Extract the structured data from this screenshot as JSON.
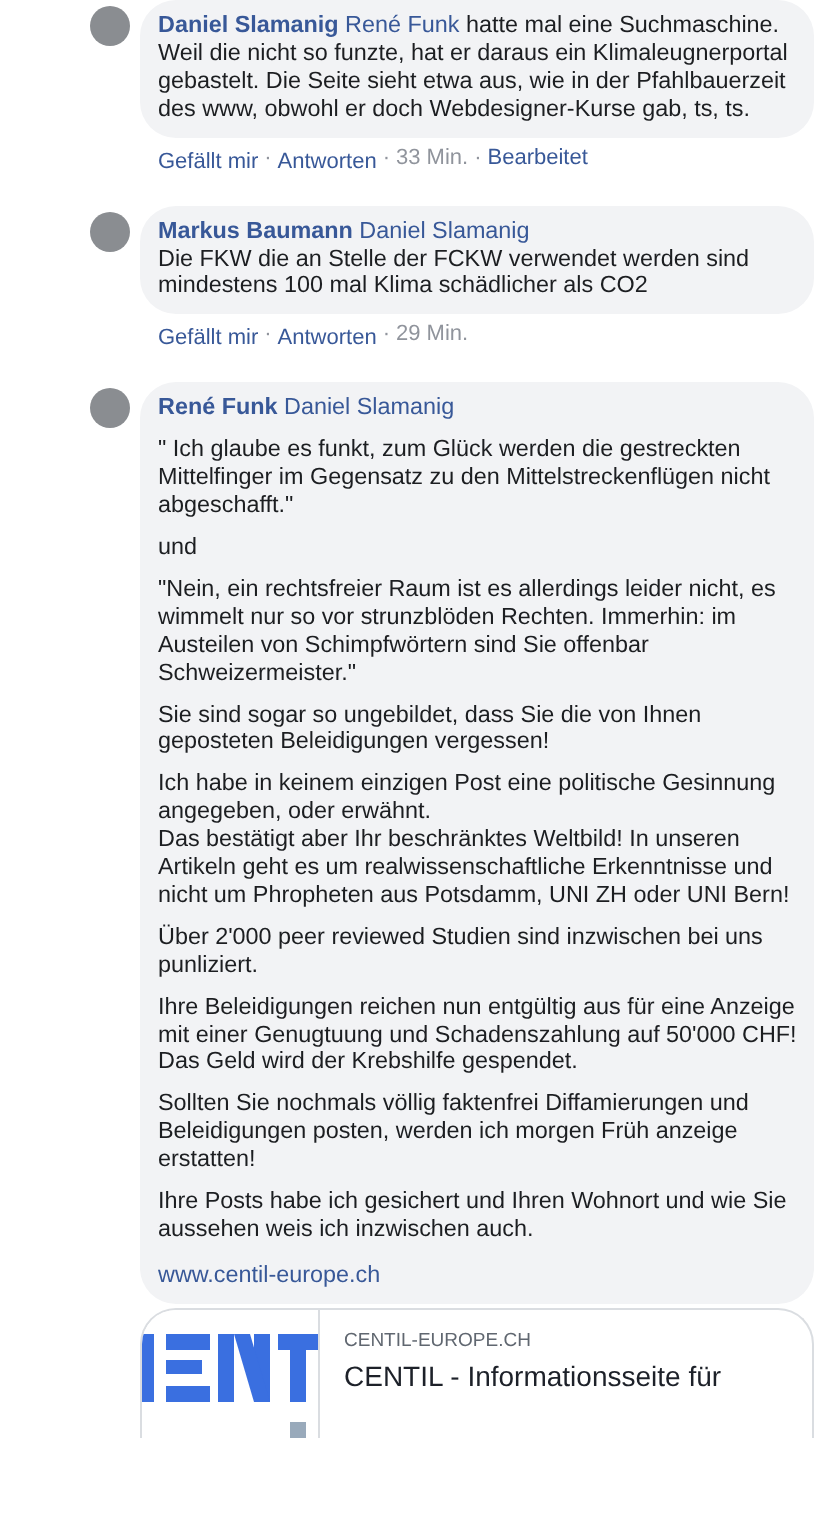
{
  "separator": "·",
  "comments": [
    {
      "author": "Daniel Slamanig",
      "mention": "René Funk",
      "kind": "inline",
      "paragraphs": [
        "hatte mal eine Suchmaschine. Weil die nicht so funzte, hat er daraus ein Klimaleugnerportal gebastelt. Die Seite sieht etwa aus, wie in der Pfahlbauerzeit des www, obwohl er doch Webdesigner-Kurse gab, ts, ts."
      ],
      "meta": [
        {
          "label": "Gefällt mir",
          "kind": "link"
        },
        {
          "label": "Antworten",
          "kind": "link"
        },
        {
          "label": "33 Min.",
          "kind": "time"
        },
        {
          "label": "Bearbeitet",
          "kind": "note"
        }
      ]
    },
    {
      "author": "Markus Baumann",
      "mention": "Daniel Slamanig",
      "kind": "stacked",
      "paragraphs": [
        "Die FKW die an Stelle der FCKW verwendet werden sind mindestens 100 mal Klima schädlicher als CO2"
      ],
      "meta": [
        {
          "label": "Gefällt mir",
          "kind": "link"
        },
        {
          "label": "Antworten",
          "kind": "link"
        },
        {
          "label": "29 Min.",
          "kind": "time"
        }
      ]
    },
    {
      "author": "René Funk",
      "mention": "Daniel Slamanig",
      "kind": "block",
      "paragraphs": [
        "\" Ich glaube es funkt, zum Glück werden die gestreckten Mittelfinger im Gegensatz zu den Mittelstreckenflügen nicht abgeschafft.\"",
        "und",
        "\"Nein, ein rechtsfreier Raum ist es allerdings leider nicht, es wimmelt nur so vor strunzblöden Rechten. Immerhin: im Austeilen von Schimpfwörtern sind Sie offenbar Schweizermeister.\"",
        "Sie sind sogar so ungebildet, dass Sie die von Ihnen geposteten Beleidigungen vergessen!",
        "Ich habe in keinem einzigen Post eine politische Gesinnung angegeben, oder erwähnt.\nDas bestätigt aber Ihr beschränktes Weltbild! In unseren Artikeln geht es um realwissenschaftliche Erkenntnisse und nicht um Phropheten aus Potsdamm, UNI ZH oder UNI Bern!",
        "Über 2'000 peer reviewed Studien sind inzwischen bei uns punliziert.",
        "Ihre Beleidigungen reichen nun entgültig aus für eine Anzeige mit einer Genugtuung und Schadenszahlung auf 50'000 CHF! Das Geld wird der Krebshilfe gespendet.",
        "Sollten Sie nochmals völlig faktenfrei Diffamierungen und Beleidigungen posten, werden ich morgen Früh anzeige erstatten!",
        "Ihre Posts habe ich gesichert und Ihren Wohnort und wie Sie aussehen weis ich inzwischen auch."
      ],
      "link": "www.centil-europe.ch",
      "preview": {
        "domain": "CENTIL-EUROPE.CH",
        "title": "CENTIL - Informationsseite für"
      }
    }
  ]
}
